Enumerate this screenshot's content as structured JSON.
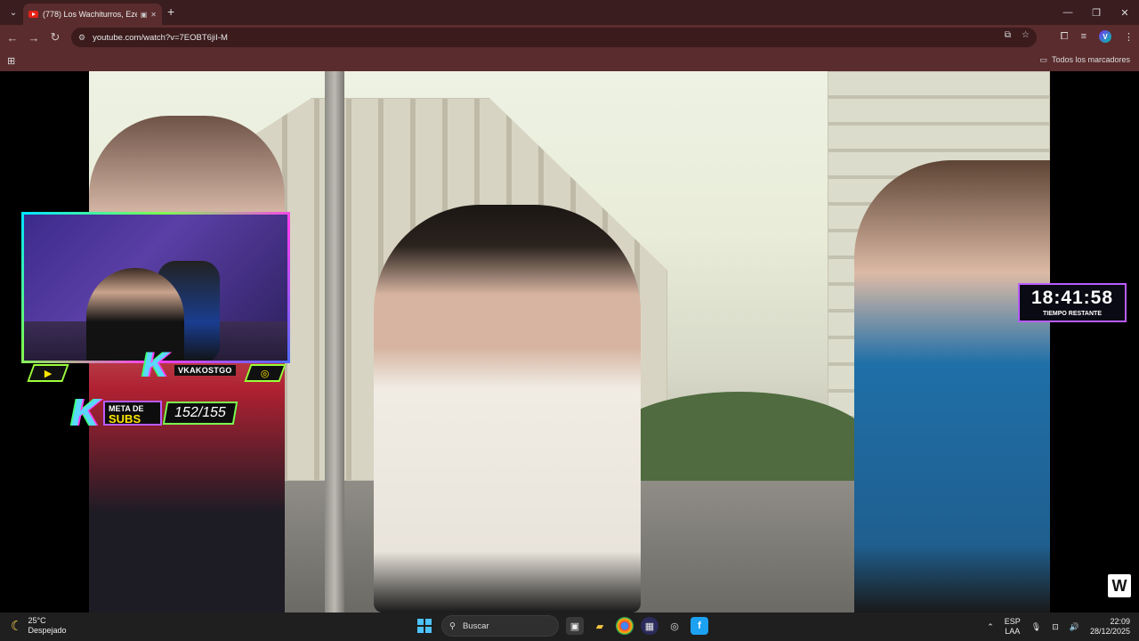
{
  "browser": {
    "tab_title": "(778) Los Wachiturros, Ezeq",
    "url": "youtube.com/watch?v=7EOBT6jiI-M",
    "bookmarks_label": "Todos los marcadores"
  },
  "overlay": {
    "handle": "VKAKOSTGO",
    "meta_line1": "META DE",
    "meta_line2": "SUBS",
    "subs_count": "152/155",
    "timer": "18:41:58",
    "timer_label": "TIEMPO RESTANTE",
    "k_logo": "K",
    "badge": "W"
  },
  "taskbar": {
    "temperature": "25°C",
    "condition": "Despejado",
    "search_placeholder": "Buscar",
    "lang_1": "ESP",
    "lang_2": "LAA",
    "time": "22:09",
    "date": "28/12/2025"
  },
  "colors": {
    "chrome_frame": "#3a1d1e",
    "chrome_toolbar": "#5a2c2d",
    "overlay_green": "#7cff4f",
    "overlay_purple": "#b85cff",
    "overlay_yellow": "#ffe600"
  }
}
